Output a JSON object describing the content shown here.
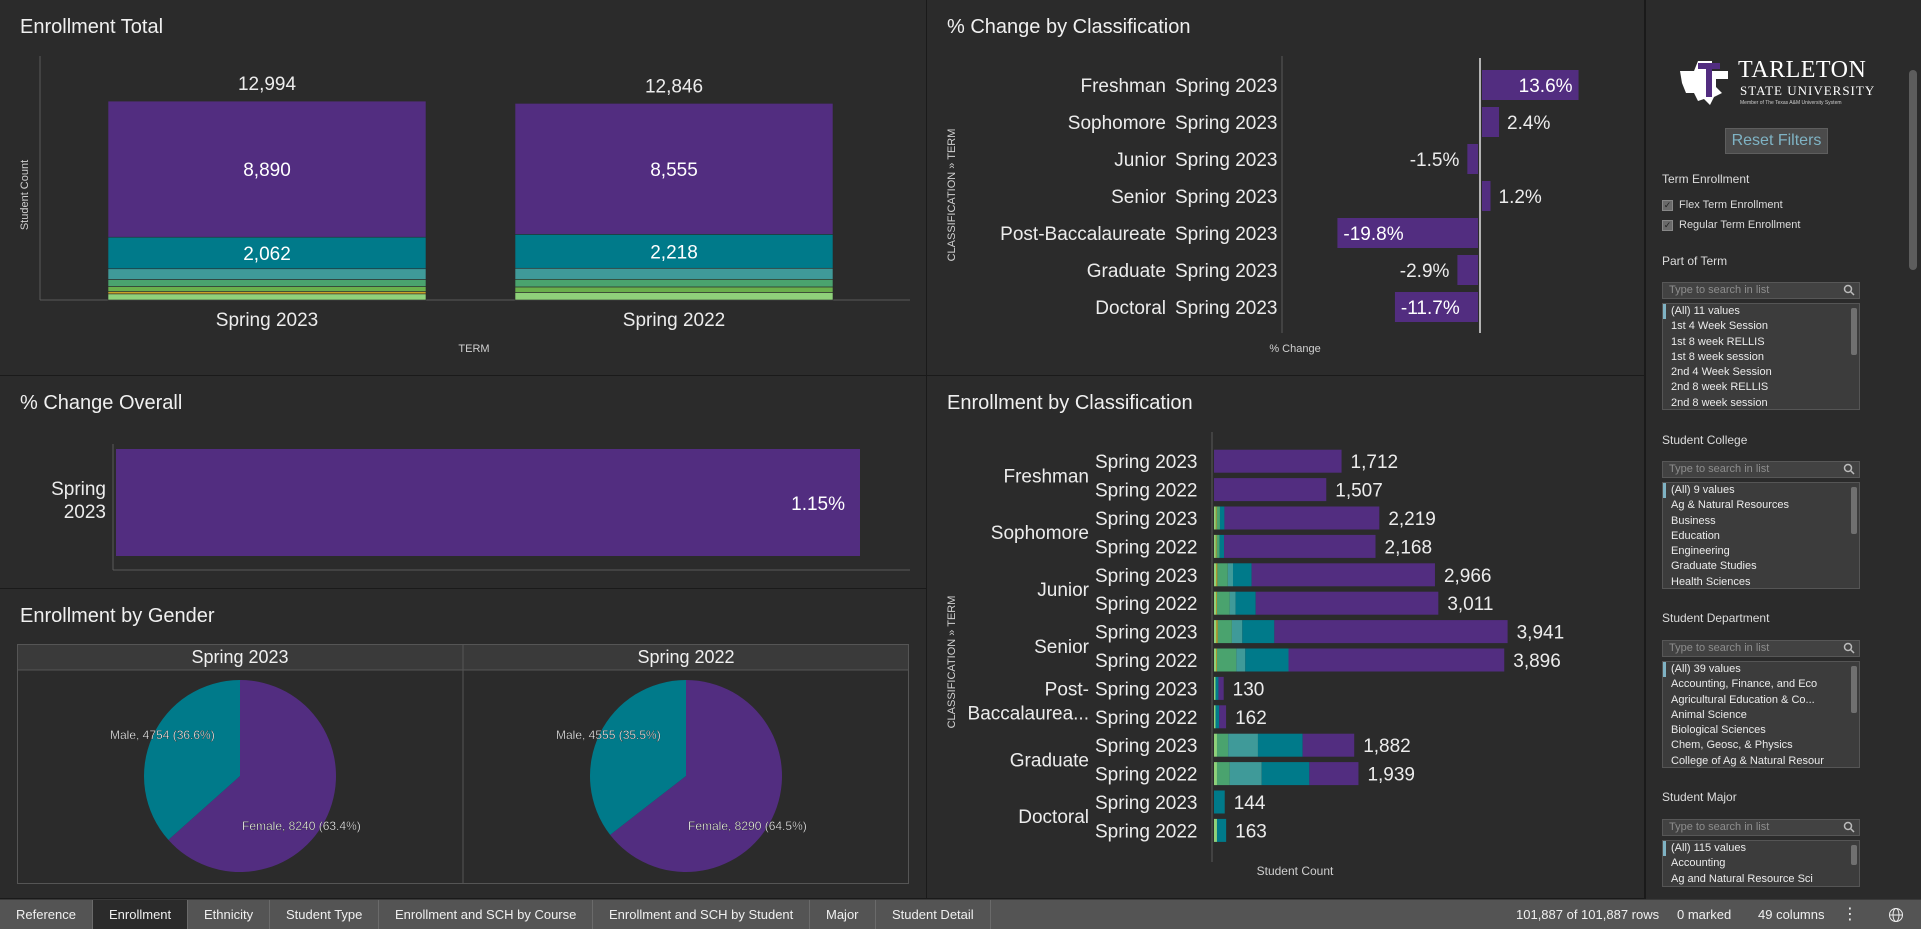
{
  "panels": {
    "enrollment_total": {
      "title": "Enrollment Total",
      "ylabel": "Student Count",
      "xlabel": "TERM",
      "bars": [
        {
          "term": "Spring 2023",
          "total": "12,994",
          "segments": [
            {
              "value": "8,890",
              "num": 8890,
              "color": "#522d80"
            },
            {
              "value": "2,062",
              "num": 2062,
              "color": "#007a8a"
            },
            {
              "value": "",
              "num": 700,
              "color": "#3f9a99"
            },
            {
              "value": "",
              "num": 460,
              "color": "#4aa36e"
            },
            {
              "value": "",
              "num": 330,
              "color": "#6ab04c"
            },
            {
              "value": "",
              "num": 150,
              "color": "#c9a227"
            },
            {
              "value": "",
              "num": 402,
              "color": "#8fd17a"
            }
          ]
        },
        {
          "term": "Spring 2022",
          "total": "12,846",
          "segments": [
            {
              "value": "8,555",
              "num": 8555,
              "color": "#522d80"
            },
            {
              "value": "2,218",
              "num": 2218,
              "color": "#007a8a"
            },
            {
              "value": "",
              "num": 720,
              "color": "#3f9a99"
            },
            {
              "value": "",
              "num": 500,
              "color": "#4aa36e"
            },
            {
              "value": "",
              "num": 360,
              "color": "#6ab04c"
            },
            {
              "value": "",
              "num": 493,
              "color": "#8fd17a"
            }
          ]
        }
      ]
    },
    "pct_by_class": {
      "title": "% Change by Classification",
      "ylabel": "CLASSIFICATION » TERM",
      "xlabel": "% Change",
      "rows": [
        {
          "class": "Freshman",
          "term": "Spring 2023",
          "label": "13.6%",
          "value": 13.6
        },
        {
          "class": "Sophomore",
          "term": "Spring 2023",
          "label": "2.4%",
          "value": 2.4
        },
        {
          "class": "Junior",
          "term": "Spring 2023",
          "label": "-1.5%",
          "value": -1.5
        },
        {
          "class": "Senior",
          "term": "Spring 2023",
          "label": "1.2%",
          "value": 1.2
        },
        {
          "class": "Post-Baccalaureate",
          "term": "Spring 2023",
          "label": "-19.8%",
          "value": -19.8
        },
        {
          "class": "Graduate",
          "term": "Spring 2023",
          "label": "-2.9%",
          "value": -2.9
        },
        {
          "class": "Doctoral",
          "term": "Spring 2023",
          "label": "-11.7%",
          "value": -11.7
        }
      ]
    },
    "pct_overall": {
      "title": "% Change Overall",
      "term_line1": "Spring",
      "term_line2": "2023",
      "label": "1.15%",
      "value": 1.15
    },
    "gender": {
      "title": "Enrollment by Gender",
      "pies": [
        {
          "term": "Spring 2023",
          "male_label": "Male, 4754 (36.6%)",
          "female_label": "Female, 8240 (63.4%)",
          "male_pct": 36.6
        },
        {
          "term": "Spring 2022",
          "male_label": "Male, 4555 (35.5%)",
          "female_label": "Female, 8290 (64.5%)",
          "male_pct": 35.5
        }
      ],
      "colors": {
        "male": "#007a8a",
        "female": "#522d80"
      }
    },
    "enroll_by_class": {
      "title": "Enrollment by Classification",
      "ylabel": "CLASSIFICATION » TERM",
      "xlabel": "Student Count",
      "groups": [
        {
          "class1": "Freshman",
          "class2": "",
          "rows": [
            {
              "term": "Spring 2023",
              "label": "1,712",
              "total": 1712,
              "segs": []
            },
            {
              "term": "Spring 2022",
              "label": "1,507",
              "total": 1507,
              "segs": []
            }
          ]
        },
        {
          "class1": "Sophomore",
          "class2": "",
          "rows": [
            {
              "term": "Spring 2023",
              "label": "2,219",
              "total": 2219,
              "segs": [
                [
                  25,
                  "#8fd17a"
                ],
                [
                  10,
                  "#c9a227"
                ],
                [
                  45,
                  "#4aa36e"
                ],
                [
                  60,
                  "#007a8a"
                ]
              ]
            },
            {
              "term": "Spring 2022",
              "label": "2,168",
              "total": 2168,
              "segs": [
                [
                  25,
                  "#8fd17a"
                ],
                [
                  10,
                  "#c9a227"
                ],
                [
                  40,
                  "#4aa36e"
                ],
                [
                  60,
                  "#007a8a"
                ]
              ]
            }
          ]
        },
        {
          "class1": "Junior",
          "class2": "",
          "rows": [
            {
              "term": "Spring 2023",
              "label": "2,966",
              "total": 2966,
              "segs": [
                [
                  30,
                  "#8fd17a"
                ],
                [
                  15,
                  "#c9a227"
                ],
                [
                  140,
                  "#4aa36e"
                ],
                [
                  70,
                  "#3f9a99"
                ],
                [
                  250,
                  "#007a8a"
                ]
              ]
            },
            {
              "term": "Spring 2022",
              "label": "3,011",
              "total": 3011,
              "segs": [
                [
                  30,
                  "#8fd17a"
                ],
                [
                  10,
                  "#c9a227"
                ],
                [
                  170,
                  "#4aa36e"
                ],
                [
                  80,
                  "#3f9a99"
                ],
                [
                  270,
                  "#007a8a"
                ]
              ]
            }
          ]
        },
        {
          "class1": "Senior",
          "class2": "",
          "rows": [
            {
              "term": "Spring 2023",
              "label": "3,941",
              "total": 3941,
              "segs": [
                [
                  30,
                  "#8fd17a"
                ],
                [
                  20,
                  "#c9a227"
                ],
                [
                  190,
                  "#4aa36e"
                ],
                [
                  140,
                  "#3f9a99"
                ],
                [
                  430,
                  "#007a8a"
                ]
              ]
            },
            {
              "term": "Spring 2022",
              "label": "3,896",
              "total": 3896,
              "segs": [
                [
                  30,
                  "#8fd17a"
                ],
                [
                  10,
                  "#c9a227"
                ],
                [
                  260,
                  "#4aa36e"
                ],
                [
                  120,
                  "#3f9a99"
                ],
                [
                  580,
                  "#007a8a"
                ]
              ]
            }
          ]
        },
        {
          "class1": "Post-",
          "class2": "Baccalaurea...",
          "rows": [
            {
              "term": "Spring 2023",
              "label": "130",
              "total": 130,
              "segs": [
                [
                  20,
                  "#8fd17a"
                ],
                [
                  40,
                  "#007a8a"
                ]
              ]
            },
            {
              "term": "Spring 2022",
              "label": "162",
              "total": 162,
              "segs": [
                [
                  20,
                  "#8fd17a"
                ],
                [
                  50,
                  "#007a8a"
                ]
              ]
            }
          ]
        },
        {
          "class1": "Graduate",
          "class2": "",
          "rows": [
            {
              "term": "Spring 2023",
              "label": "1,882",
              "total": 1882,
              "segs": [
                [
                  40,
                  "#8fd17a"
                ],
                [
                  150,
                  "#4aa36e"
                ],
                [
                  400,
                  "#3f9a99"
                ],
                [
                  600,
                  "#007a8a"
                ]
              ]
            },
            {
              "term": "Spring 2022",
              "label": "1,939",
              "total": 1939,
              "segs": [
                [
                  40,
                  "#8fd17a"
                ],
                [
                  170,
                  "#4aa36e"
                ],
                [
                  430,
                  "#3f9a99"
                ],
                [
                  640,
                  "#007a8a"
                ]
              ]
            }
          ]
        },
        {
          "class1": "Doctoral",
          "class2": "",
          "rows": [
            {
              "term": "Spring 2023",
              "label": "144",
              "total": 144,
              "segs": [
                [
                  144,
                  "#007a8a"
                ]
              ]
            },
            {
              "term": "Spring 2022",
              "label": "163",
              "total": 163,
              "segs": [
                [
                  40,
                  "#8fd17a"
                ],
                [
                  123,
                  "#007a8a"
                ]
              ]
            }
          ]
        }
      ]
    }
  },
  "sidebar": {
    "logo_name": "TARLETON",
    "logo_sub": "STATE UNIVERSITY",
    "logo_tag": "Member of The Texas A&M University System",
    "reset_label": "Reset Filters",
    "term_enrollment_label": "Term Enrollment",
    "flex_label": "Flex Term Enrollment",
    "regular_label": "Regular Term Enrollment",
    "search_placeholder": "Type to search in list",
    "part_of_term": {
      "label": "Part of Term",
      "items": [
        "(All) 11 values",
        "1st 4 Week Session",
        "1st 8 week RELLIS",
        "1st 8 week session",
        "2nd 4 Week Session",
        "2nd 8 week RELLIS",
        "2nd 8 week session"
      ]
    },
    "student_college": {
      "label": "Student College",
      "items": [
        "(All) 9 values",
        "Ag & Natural Resources",
        "Business",
        "Education",
        "Engineering",
        "Graduate Studies",
        "Health Sciences"
      ]
    },
    "student_department": {
      "label": "Student Department",
      "items": [
        "(All) 39 values",
        "Accounting, Finance, and Eco",
        "Agricultural Education & Co...",
        "Animal Science",
        "Biological Sciences",
        "Chem, Geosc, & Physics",
        "College of Ag & Natural Resour"
      ]
    },
    "student_major": {
      "label": "Student Major",
      "items": [
        "(All) 115 values",
        "Accounting",
        "Ag and Natural Resource Sci"
      ]
    }
  },
  "statusbar": {
    "tabs": [
      "Reference",
      "Enrollment",
      "Ethnicity",
      "Student Type",
      "Enrollment and SCH by Course",
      "Enrollment and SCH by Student",
      "Major",
      "Student Detail"
    ],
    "active_tab": 1,
    "rows_text": "101,887 of 101,887 rows",
    "marked_text": "0 marked",
    "columns_text": "49 columns"
  }
}
